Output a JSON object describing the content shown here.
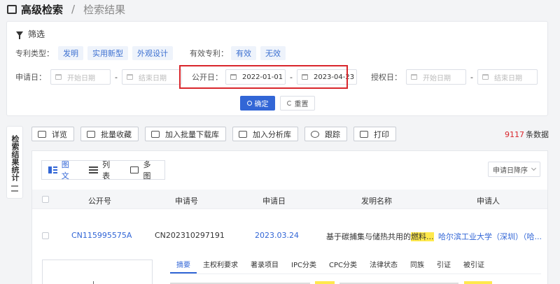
{
  "breadcrumb": {
    "current": "高级检索",
    "separator": "/",
    "result": "检索结果"
  },
  "filter": {
    "title": "筛选",
    "patent_type": {
      "label": "专利类型：",
      "options": [
        "发明",
        "实用新型",
        "外观设计"
      ]
    },
    "validity": {
      "label": "有效专利：",
      "options": [
        "有效",
        "无效"
      ]
    },
    "apply_date": {
      "label": "申请日：",
      "start_placeholder": "开始日期",
      "end_placeholder": "结束日期"
    },
    "publish_date": {
      "label": "公开日：",
      "start": "2022-01-01",
      "end": "2023-04-23"
    },
    "grant_date": {
      "label": "授权日：",
      "start_placeholder": "开始日期",
      "end_placeholder": "结束日期"
    },
    "confirm": "确定",
    "reset": "重置",
    "dash": "-"
  },
  "stats_panel": {
    "label": "检索结果统计"
  },
  "toolbar": {
    "buttons": [
      "详览",
      "批量收藏",
      "加入批量下载库",
      "加入分析库",
      "跟踪",
      "打印"
    ]
  },
  "result_count": {
    "value": "9117",
    "unit": "条数据"
  },
  "view_tabs": [
    "图文",
    "列表",
    "多图"
  ],
  "sort": {
    "selected": "申请日降序"
  },
  "table": {
    "headers": [
      "公开号",
      "申请号",
      "申请日",
      "发明名称",
      "申请人"
    ],
    "rows": [
      {
        "pub_no": "CN115995575A",
        "app_no": "CN202310297191",
        "app_date": "2023.03.24",
        "title_prefix": "基于碳捕集与储热共用的",
        "title_highlight": "燃料...",
        "applicant": "哈尔滨工业大学（深圳）（哈..."
      }
    ]
  },
  "detail_tabs": [
    "摘要",
    "主权利要求",
    "著录项目",
    "IPC分类",
    "CPC分类",
    "法律状态",
    "同族",
    "引证",
    "被引证"
  ],
  "colors": {
    "accent": "#3266d6",
    "highlight": "#ffe94d",
    "count": "#d9262c",
    "box": "#d9262c"
  }
}
